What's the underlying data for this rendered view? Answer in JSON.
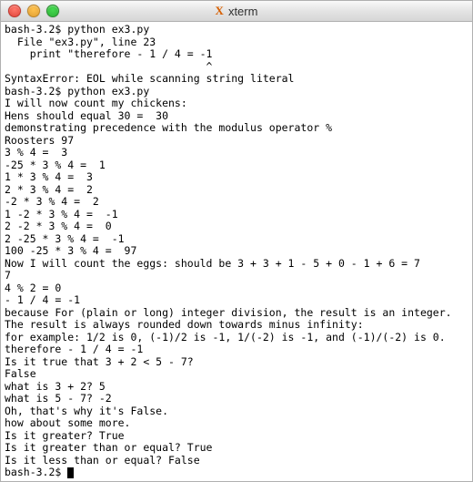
{
  "window": {
    "title": "xterm"
  },
  "terminal": {
    "lines": [
      "bash-3.2$ python ex3.py",
      "  File \"ex3.py\", line 23",
      "    print \"therefore - 1 / 4 = -1",
      "                                ^",
      "SyntaxError: EOL while scanning string literal",
      "bash-3.2$ python ex3.py",
      "I will now count my chickens:",
      "Hens should equal 30 =  30",
      "demonstrating precedence with the modulus operator %",
      "Roosters 97",
      "3 % 4 =  3",
      "-25 * 3 % 4 =  1",
      "1 * 3 % 4 =  3",
      "2 * 3 % 4 =  2",
      "-2 * 3 % 4 =  2",
      "1 -2 * 3 % 4 =  -1",
      "2 -2 * 3 % 4 =  0",
      "2 -25 * 3 % 4 =  -1",
      "100 -25 * 3 % 4 =  97",
      "Now I will count the eggs: should be 3 + 3 + 1 - 5 + 0 - 1 + 6 = 7",
      "7",
      "4 % 2 = 0",
      "- 1 / 4 = -1",
      "because For (plain or long) integer division, the result is an integer.",
      "The result is always rounded down towards minus infinity:",
      "for example: 1/2 is 0, (-1)/2 is -1, 1/(-2) is -1, and (-1)/(-2) is 0.",
      "therefore - 1 / 4 = -1",
      "Is it true that 3 + 2 < 5 - 7?",
      "False",
      "what is 3 + 2? 5",
      "what is 5 - 7? -2",
      "Oh, that's why it's False.",
      "how about some more.",
      "Is it greater? True",
      "Is it greater than or equal? True",
      "Is it less than or equal? False",
      "bash-3.2$ "
    ]
  }
}
